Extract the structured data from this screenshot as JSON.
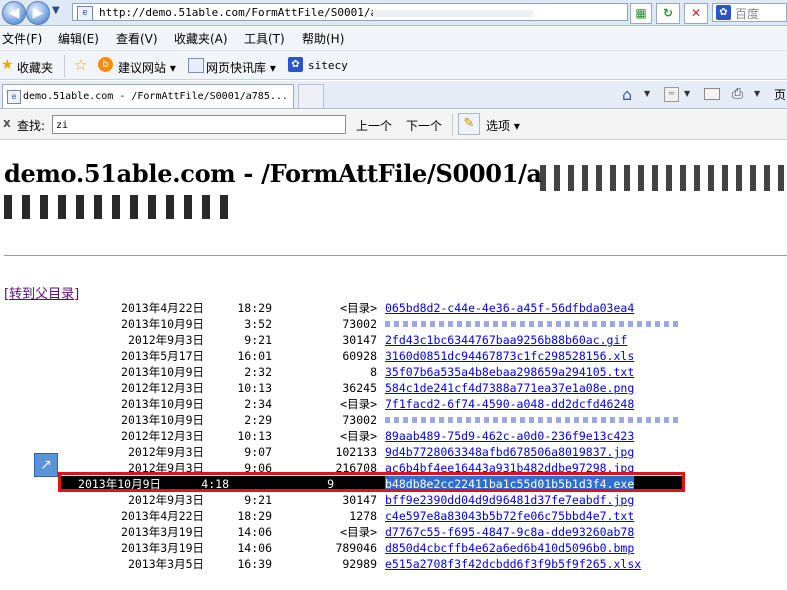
{
  "browser": {
    "url": "http://demo.51able.com/FormAttFile/S0001/a",
    "search_placeholder": "百度",
    "menu": [
      "文件(F)",
      "编辑(E)",
      "查看(V)",
      "收藏夹(A)",
      "工具(T)",
      "帮助(H)"
    ],
    "favorites_label": "收藏夹",
    "fav_items": [
      "建议网站 ▾",
      "网页快讯库 ▾",
      "sitecy"
    ],
    "tab_title": "demo.51able.com - /FormAttFile/S0001/a785...",
    "page_menu_label": "页"
  },
  "find_bar": {
    "close": "x",
    "label": "查找:",
    "query": "zi",
    "prev": "上一个",
    "next": "下一个",
    "options": "选项 ▾"
  },
  "page": {
    "title": "demo.51able.com - /FormAttFile/S0001/a",
    "parent_link": "[转到父目录]",
    "rows": [
      {
        "date": "2013年4月22日",
        "time": "18:29",
        "size": "<目录>",
        "name": "065bd8d2-c44e-4e36-a45f-56dfbda03ea4"
      },
      {
        "date": "2013年10月9日",
        "time": "3:52",
        "size": "73002",
        "name": ""
      },
      {
        "date": "2012年9月3日",
        "time": "9:21",
        "size": "30147",
        "name": "2fd43c1bc6344767baa9256b88b60ac.gif"
      },
      {
        "date": "2013年5月17日",
        "time": "16:01",
        "size": "60928",
        "name": "3160d0851dc94467873c1fc298528156.xls"
      },
      {
        "date": "2013年10月9日",
        "time": "2:32",
        "size": "8",
        "name": "35f07b6a535a4b8ebaa298659a294105.txt"
      },
      {
        "date": "2012年12月3日",
        "time": "10:13",
        "size": "36245",
        "name": "584c1de241cf4d7388a771ea37e1a08e.png"
      },
      {
        "date": "2013年10月9日",
        "time": "2:34",
        "size": "<目录>",
        "name": "7f1facd2-6f74-4590-a048-dd2dcfd46248"
      },
      {
        "date": "2013年10月9日",
        "time": "2:29",
        "size": "73002",
        "name": ""
      },
      {
        "date": "2012年12月3日",
        "time": "10:13",
        "size": "<目录>",
        "name": "89aab489-75d9-462c-a0d0-236f9e13c423"
      },
      {
        "date": "2012年9月3日",
        "time": "9:07",
        "size": "102133",
        "name": "9d4b7728063348afbd678506a8019837.jpg"
      },
      {
        "date": "2012年9月3日",
        "time": "9:06",
        "size": "216708",
        "name": "ac6b4bf4ee16443a931b482ddbe97298.jpg"
      },
      {
        "date": "2013年10月9日",
        "time": "4:18",
        "size": "9",
        "name": "b48db8e2cc22411ba1c55d01b5b1d3f4.exe"
      },
      {
        "date": "2012年9月3日",
        "time": "9:21",
        "size": "30147",
        "name": "bff9e2390dd04d9d96481d37fe7eabdf.jpg"
      },
      {
        "date": "2013年4月22日",
        "time": "18:29",
        "size": "1278",
        "name": "c4e597e8a83043b5b72fe06c75bbd4e7.txt"
      },
      {
        "date": "2013年3月19日",
        "time": "14:06",
        "size": "<目录>",
        "name": "d7767c55-f695-4847-9c8a-dde93260ab78"
      },
      {
        "date": "2013年3月19日",
        "time": "14:06",
        "size": "789046",
        "name": "d850d4cbcffb4e62a6ed6b410d5096b0.bmp"
      },
      {
        "date": "2013年3月5日",
        "time": "16:39",
        "size": "92989",
        "name": "e515a2708f3f42dcbdd6f3f9b5f9f265.xlsx"
      }
    ]
  },
  "colors": {
    "highlight": "#e3121a",
    "link": "#0000ee",
    "visited": "#5a0a7a"
  }
}
